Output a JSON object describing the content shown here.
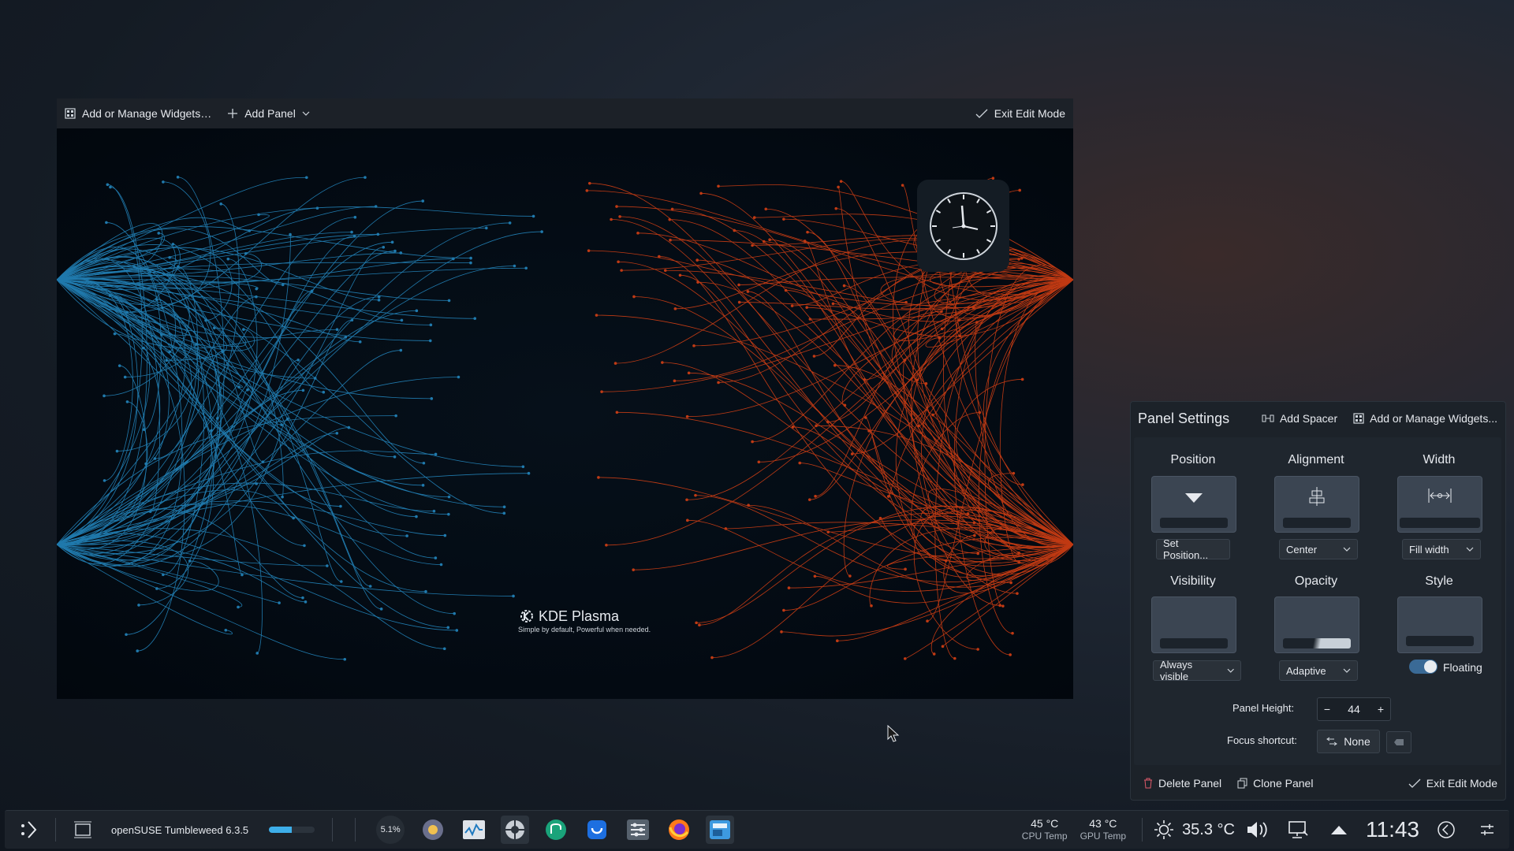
{
  "edit_toolbar": {
    "manage_widgets": "Add or Manage Widgets…",
    "add_panel": "Add Panel",
    "exit_edit": "Exit Edit Mode"
  },
  "wallpaper": {
    "brand": "KDE Plasma",
    "tagline": "Simple by default, Powerful when needed."
  },
  "panel_settings": {
    "title": "Panel Settings",
    "add_spacer": "Add Spacer",
    "manage_widgets": "Add or Manage Widgets...",
    "position": {
      "title": "Position",
      "button": "Set Position..."
    },
    "alignment": {
      "title": "Alignment",
      "value": "Center"
    },
    "width": {
      "title": "Width",
      "value": "Fill width"
    },
    "visibility": {
      "title": "Visibility",
      "value": "Always visible"
    },
    "opacity": {
      "title": "Opacity",
      "value": "Adaptive"
    },
    "style": {
      "title": "Style",
      "toggle_label": "Floating",
      "floating": true
    },
    "panel_height": {
      "label": "Panel Height:",
      "value": "44"
    },
    "focus_shortcut": {
      "label": "Focus shortcut:",
      "value": "None"
    },
    "delete": "Delete Panel",
    "clone": "Clone Panel",
    "exit_edit": "Exit Edit Mode"
  },
  "taskbar": {
    "window_title": "openSUSE Tumbleweed 6.3.5",
    "progress": 0.5,
    "cpu_badge": "5.1%",
    "cpu_temp": {
      "value": "45 °C",
      "label": "CPU Temp"
    },
    "gpu_temp": {
      "value": "43 °C",
      "label": "GPU Temp"
    },
    "weather": "35.3 °C",
    "clock": "11:43",
    "accent": "#3daee9"
  }
}
